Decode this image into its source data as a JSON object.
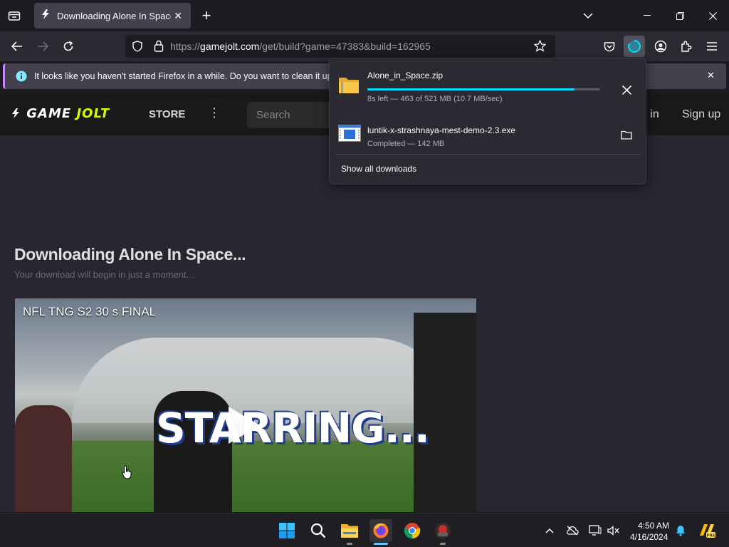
{
  "browser": {
    "tab": {
      "title": "Downloading Alone In Space - G"
    },
    "url": {
      "prefix": "https://",
      "host": "gamejolt.com",
      "path": "/get/build?game=47383&build=162965"
    },
    "notification": {
      "text": "It looks like you haven't started Firefox in a while. Do you want to clean it up for"
    }
  },
  "site": {
    "logo_game": "GAME",
    "logo_jolt": "JOLT",
    "store": "STORE",
    "search_placeholder": "Search",
    "login": "g in",
    "signup": "Sign up"
  },
  "page": {
    "title": "Downloading Alone In Space...",
    "subtitle": "Your download will begin in just a moment..."
  },
  "video": {
    "title": "NFL TNG S2 30 s FINAL",
    "caption": "STARRING..."
  },
  "downloads": {
    "items": [
      {
        "name": "Alone_in_Space.zip",
        "status": "8s left — 463 of 521 MB (10.7 MB/sec)",
        "progress": 0.89
      },
      {
        "name": "luntik-x-strashnaya-mest-demo-2.3.exe",
        "status": "Completed — 142 MB"
      }
    ],
    "show_all": "Show all downloads"
  },
  "taskbar": {
    "time": "4:50 AM",
    "date": "4/16/2024"
  },
  "colors": {
    "accent": "#00ddff",
    "tab_active": "#42414d",
    "gamejolt_green": "#ccff00"
  }
}
